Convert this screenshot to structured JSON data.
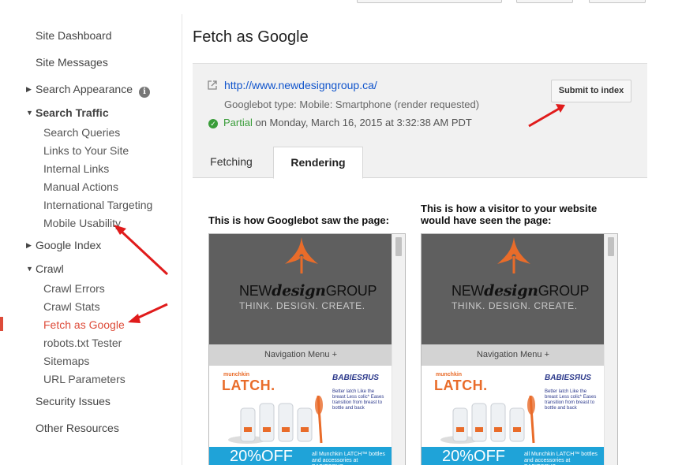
{
  "sidebar": {
    "items": [
      {
        "label": "Site Dashboard"
      },
      {
        "label": "Site Messages"
      },
      {
        "label": "Search Appearance"
      },
      {
        "label": "Search Traffic"
      },
      {
        "label": "Search Queries"
      },
      {
        "label": "Links to Your Site"
      },
      {
        "label": "Internal Links"
      },
      {
        "label": "Manual Actions"
      },
      {
        "label": "International Targeting"
      },
      {
        "label": "Mobile Usability"
      },
      {
        "label": "Google Index"
      },
      {
        "label": "Crawl"
      },
      {
        "label": "Crawl Errors"
      },
      {
        "label": "Crawl Stats"
      },
      {
        "label": "Fetch as Google"
      },
      {
        "label": "robots.txt Tester"
      },
      {
        "label": "Sitemaps"
      },
      {
        "label": "URL Parameters"
      },
      {
        "label": "Security Issues"
      },
      {
        "label": "Other Resources"
      }
    ],
    "active": "Fetch as Google"
  },
  "main": {
    "title": "Fetch as Google",
    "fetch": {
      "url": "http://www.newdesigngroup.ca/",
      "googlebot_type": "Googlebot type: Mobile: Smartphone (render requested)",
      "status": "Partial",
      "status_suffix": " on Monday, March 16, 2015 at 3:32:38 AM PDT",
      "submit_label": "Submit to index"
    },
    "tabs": [
      {
        "label": "Fetching"
      },
      {
        "label": "Rendering"
      }
    ],
    "active_tab": "Rendering",
    "captions": {
      "googlebot": "This is how Googlebot saw the page:",
      "visitor_line1": "This is how a visitor to your website",
      "visitor_line2": "would have seen the page:"
    }
  },
  "preview": {
    "brand_plain_1": "NEW",
    "brand_italic": "design",
    "brand_plain_2": "GROUP",
    "tagline": "THINK. DESIGN. CREATE.",
    "nav_menu": "Navigation Menu  +",
    "munchkin": "munchkin",
    "latch": "LATCH.",
    "babies": "BABIESЯUS",
    "promo_text": "Better latch Like the breast Less colic* Eases transition from breast to bottle and back",
    "sale_big": "20%OFF",
    "sale_small": "all Munchkin LATCH™ bottles and accessories at BABIESЯUS"
  },
  "colors": {
    "accent_red": "#dd4b39",
    "link_blue": "#1155cc",
    "status_green": "#3a9d3a",
    "logo_orange": "#e96c2a",
    "sale_blue": "#1fa3d8"
  },
  "icons": [
    "info-icon",
    "external-link-icon",
    "check-circle-icon",
    "triangle-right-icon",
    "triangle-down-icon"
  ]
}
